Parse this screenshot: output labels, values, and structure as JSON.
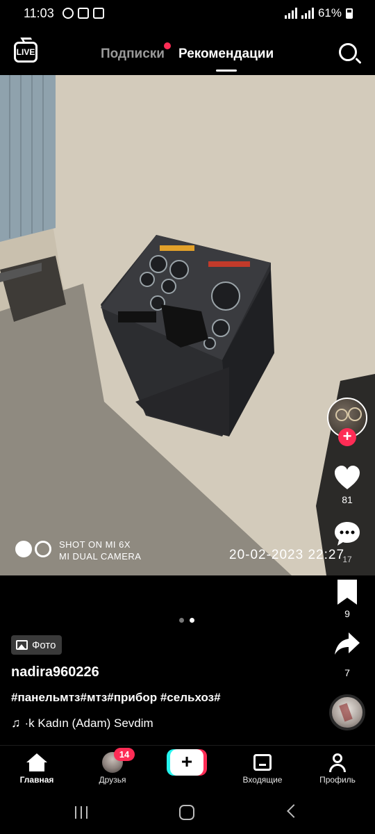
{
  "status_bar": {
    "time": "11:03",
    "battery": "61%",
    "network": "4G"
  },
  "top_nav": {
    "following_label": "Подписки",
    "for_you_label": "Рекомендации",
    "live_label": "LIVE"
  },
  "photo": {
    "watermark_line1": "SHOT ON MI 6X",
    "watermark_line2": "MI DUAL CAMERA",
    "date_stamp": "20-02-2023 22:27"
  },
  "rail": {
    "likes": "81",
    "comments": "17",
    "saves": "9",
    "shares": "7",
    "follow_symbol": "+"
  },
  "pagination": {
    "total": 2,
    "active_index": 1
  },
  "caption": {
    "badge": "Фото",
    "username": "nadira960226",
    "hashtags": "#панельмтз#мтз#прибор #сельхоз#",
    "sound": "·k Kadın (Adam) Sevdim"
  },
  "bottom_nav": {
    "home_label": "Главная",
    "friends_label": "Друзья",
    "friends_badge": "14",
    "create_symbol": "+",
    "inbox_label": "Входящие",
    "profile_label": "Профиль"
  },
  "colors": {
    "accent": "#fe2c55",
    "cyan": "#25f4ee",
    "background": "#000000"
  },
  "icons": [
    "live-icon",
    "search-icon",
    "heart-icon",
    "comment-icon",
    "bookmark-icon",
    "share-icon",
    "home-icon",
    "inbox-icon",
    "profile-icon",
    "music-note-icon"
  ]
}
